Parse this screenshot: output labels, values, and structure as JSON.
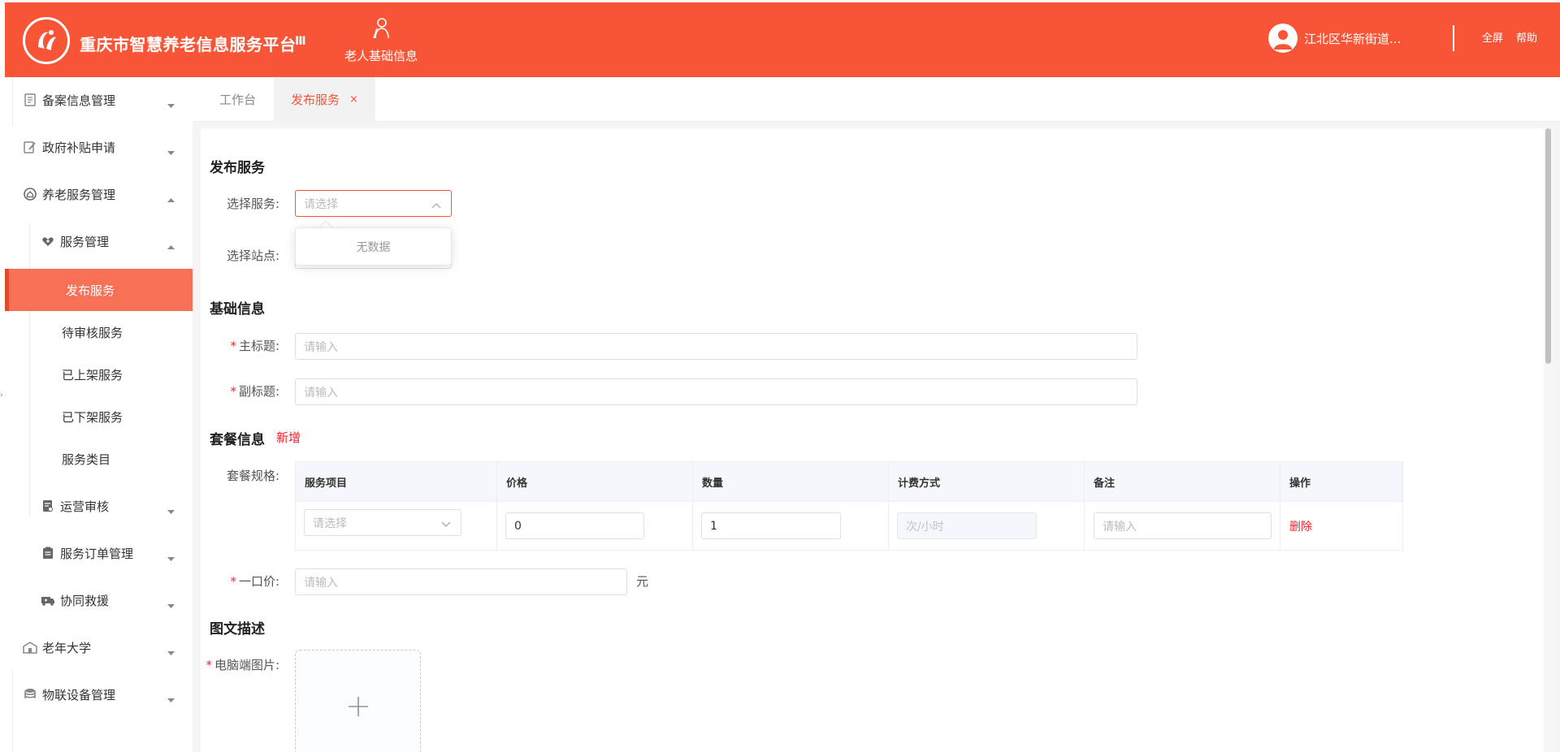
{
  "header": {
    "app_title": "重庆市智慧养老信息服务平台",
    "menu_toggle": "III",
    "top_nav_label": "老人基础信息",
    "user_name": "江北区华新街道...",
    "fullscreen_label": "全屏",
    "help_label": "帮助",
    "brand_color": "#f85536"
  },
  "sidebar": {
    "items": [
      {
        "label": "备案信息管理",
        "icon": "document-icon"
      },
      {
        "label": "政府补贴申请",
        "icon": "edit-doc-icon"
      },
      {
        "label": "养老服务管理",
        "icon": "home-circle-icon"
      },
      {
        "label": "服务管理",
        "icon": "heart-tag-icon"
      },
      {
        "label": "发布服务"
      },
      {
        "label": "待审核服务"
      },
      {
        "label": "已上架服务"
      },
      {
        "label": "已下架服务"
      },
      {
        "label": "服务类目"
      },
      {
        "label": "运营审核",
        "icon": "audit-icon"
      },
      {
        "label": "服务订单管理",
        "icon": "order-icon"
      },
      {
        "label": "协同救援",
        "icon": "ambulance-icon"
      },
      {
        "label": "老年大学",
        "icon": "school-icon"
      },
      {
        "label": "物联设备管理",
        "icon": "database-icon"
      }
    ],
    "active_color": "#f87156"
  },
  "tabs": [
    {
      "label": "工作台"
    },
    {
      "label": "发布服务",
      "close": "×"
    }
  ],
  "form": {
    "section_publish": "发布服务",
    "select_service_label": "选择服务:",
    "select_service_placeholder": "请选择",
    "dropdown_empty": "无数据",
    "select_station_label": "选择站点:",
    "section_basic": "基础信息",
    "title_label": "主标题:",
    "title_placeholder": "请输入",
    "subtitle_label": "副标题:",
    "subtitle_placeholder": "请输入",
    "section_package": "套餐信息",
    "add_label": "新增",
    "spec_label": "套餐规格:",
    "table_headers": [
      "服务项目",
      "价格",
      "数量",
      "计费方式",
      "备注",
      "操作"
    ],
    "row": {
      "service_placeholder": "请选择",
      "price": "0",
      "quantity": "1",
      "billing_placeholder": "次/小时",
      "note_placeholder": "请输入",
      "delete_label": "删除"
    },
    "fixed_price_label": "一口价:",
    "fixed_price_placeholder": "请输入",
    "unit": "元",
    "section_desc": "图文描述",
    "pc_image_label": "电脑端图片:",
    "required_mark": "*"
  }
}
